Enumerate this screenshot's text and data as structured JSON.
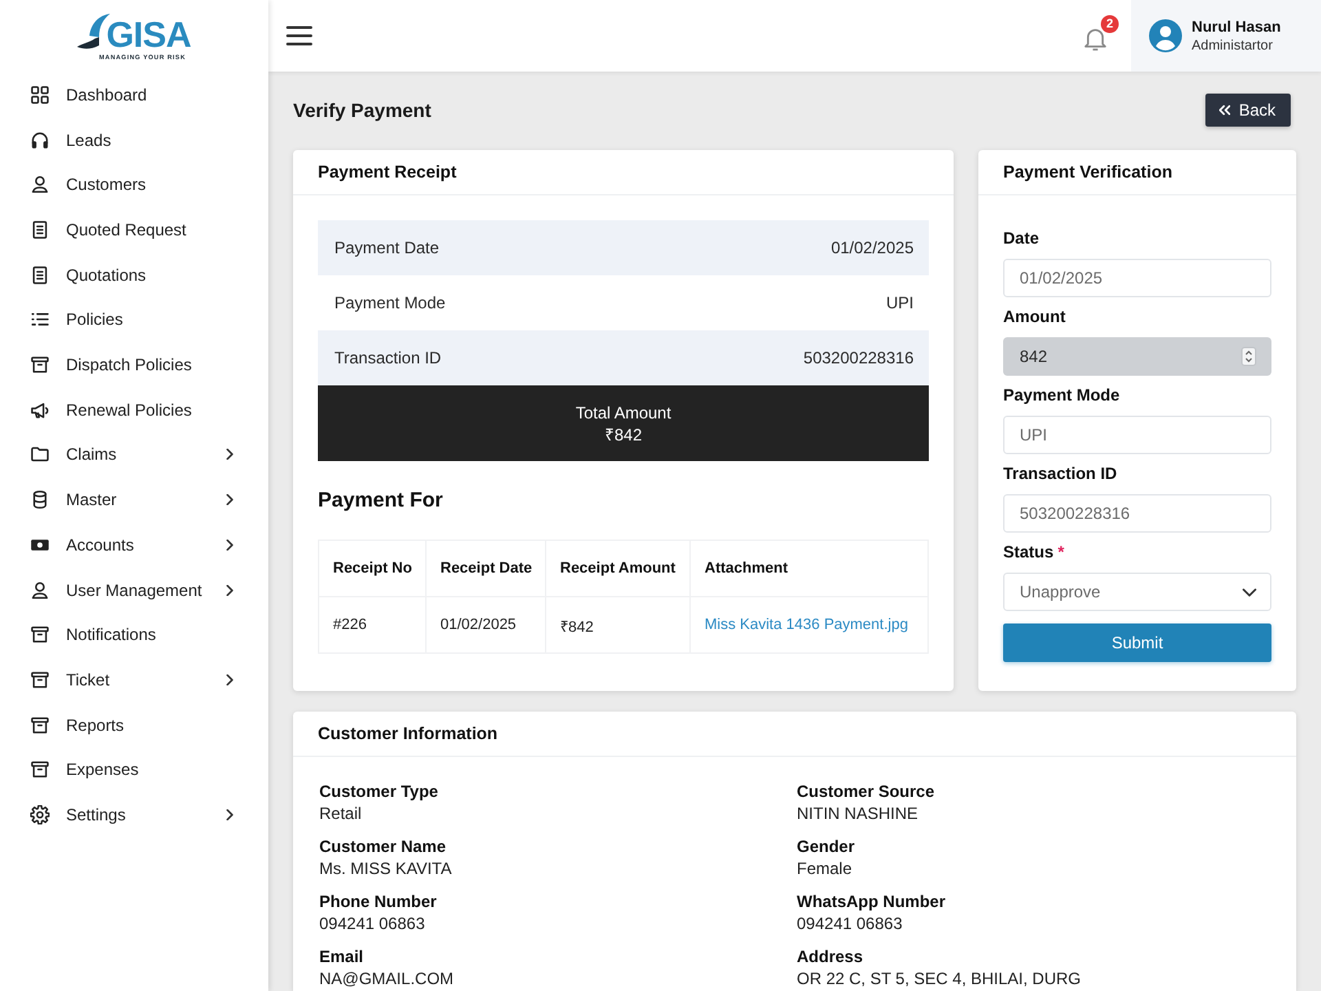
{
  "logo": {
    "name": "GISA",
    "tagline": "MANAGING YOUR RISK"
  },
  "sidebar": {
    "items": [
      {
        "label": "Dashboard",
        "has_submenu": false
      },
      {
        "label": "Leads",
        "has_submenu": false
      },
      {
        "label": "Customers",
        "has_submenu": false
      },
      {
        "label": "Quoted Request",
        "has_submenu": false
      },
      {
        "label": "Quotations",
        "has_submenu": false
      },
      {
        "label": "Policies",
        "has_submenu": false
      },
      {
        "label": "Dispatch Policies",
        "has_submenu": false
      },
      {
        "label": "Renewal Policies",
        "has_submenu": false
      },
      {
        "label": "Claims",
        "has_submenu": true
      },
      {
        "label": "Master",
        "has_submenu": true
      },
      {
        "label": "Accounts",
        "has_submenu": true
      },
      {
        "label": "User Management",
        "has_submenu": true
      },
      {
        "label": "Notifications",
        "has_submenu": false
      },
      {
        "label": "Ticket",
        "has_submenu": true
      },
      {
        "label": "Reports",
        "has_submenu": false
      },
      {
        "label": "Expenses",
        "has_submenu": false
      },
      {
        "label": "Settings",
        "has_submenu": true
      }
    ]
  },
  "topbar": {
    "notification_count": "2",
    "user": {
      "name": "Nurul Hasan",
      "role": "Administartor"
    }
  },
  "page": {
    "title": "Verify Payment",
    "back_button": "Back"
  },
  "payment_receipt": {
    "title": "Payment Receipt",
    "details": [
      {
        "label": "Payment Date",
        "value": "01/02/2025"
      },
      {
        "label": "Payment Mode",
        "value": "UPI"
      },
      {
        "label": "Transaction ID",
        "value": "503200228316"
      }
    ],
    "total": {
      "label": "Total Amount",
      "value": "₹842"
    },
    "payment_for": {
      "title": "Payment For",
      "columns": [
        "Receipt No",
        "Receipt Date",
        "Receipt Amount",
        "Attachment"
      ],
      "rows": [
        {
          "cells": [
            {
              "kind": "text",
              "text": "#226"
            },
            {
              "kind": "text",
              "text": "01/02/2025"
            },
            {
              "kind": "text",
              "text": "₹842"
            },
            {
              "kind": "link",
              "text": "Miss Kavita 1436 Payment.jpg"
            }
          ]
        }
      ]
    }
  },
  "payment_verification": {
    "title": "Payment Verification",
    "fields": [
      {
        "label": "Date",
        "kind": "text",
        "value": "01/02/2025",
        "disabled": false
      },
      {
        "label": "Amount",
        "kind": "number",
        "value": "842",
        "disabled": true
      },
      {
        "label": "Payment Mode",
        "kind": "text",
        "value": "UPI",
        "disabled": false
      },
      {
        "label": "Transaction ID",
        "kind": "text",
        "value": "503200228316",
        "disabled": false
      },
      {
        "label": "Status",
        "kind": "select",
        "value": "Unapprove",
        "disabled": false,
        "required_mark": "*"
      }
    ],
    "submit_button": "Submit"
  },
  "customer_information": {
    "title": "Customer Information",
    "fields": [
      {
        "label": "Customer Type",
        "value": "Retail"
      },
      {
        "label": "Customer Source",
        "value": "NITIN NASHINE"
      },
      {
        "label": "Customer Name",
        "value": "Ms. MISS KAVITA"
      },
      {
        "label": "Gender",
        "value": "Female"
      },
      {
        "label": "Phone Number",
        "value": "094241 06863"
      },
      {
        "label": "WhatsApp Number",
        "value": "094241 06863"
      },
      {
        "label": "Email",
        "value": "NA@GMAIL.COM"
      },
      {
        "label": "Address",
        "value": "OR 22 C, ST 5, SEC 4, BHILAI, DURG"
      }
    ]
  }
}
